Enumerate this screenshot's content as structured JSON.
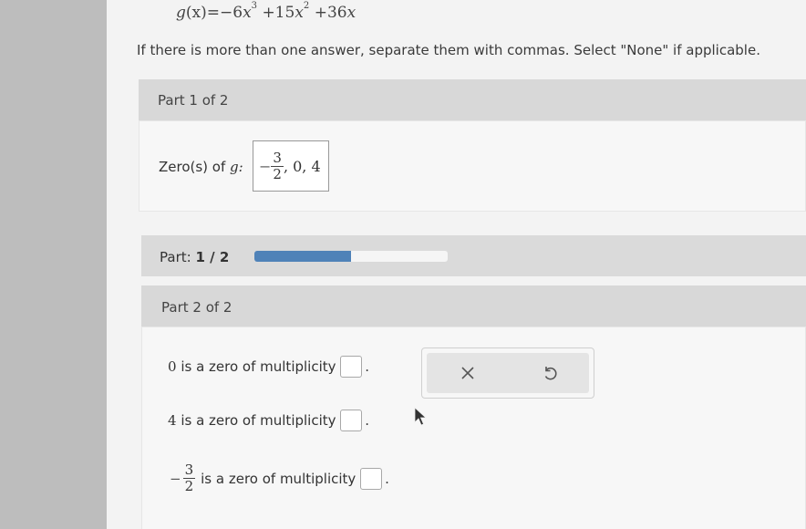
{
  "equation": {
    "lhs": "g",
    "arg": "(x)",
    "c1": "−6",
    "p1": "3",
    "op2": "+15",
    "p2": "2",
    "op3": "+36"
  },
  "instructions": "If there is more than one answer, separate them with commas. Select \"None\" if applicable.",
  "part1": {
    "header": "Part 1 of 2",
    "zero_label": "Zero(s) of",
    "zero_func": "g:",
    "answer": {
      "neg": "−",
      "num": "3",
      "den": "2",
      "rest": ", 0, 4"
    }
  },
  "progress": {
    "label": "Part:",
    "value_text": "1 / 2",
    "fraction": 0.5,
    "color": "#4f82b8"
  },
  "part2": {
    "header": "Part 2 of 2",
    "rows": [
      {
        "zero": "0",
        "text": "is a zero of multiplicity"
      },
      {
        "zero": "4",
        "text": "is a zero of multiplicity"
      },
      {
        "neg": "−",
        "num": "3",
        "den": "2",
        "text": "is a zero of multiplicity"
      }
    ],
    "period": "."
  },
  "tools": {
    "clear_icon": "x-icon",
    "undo_icon": "undo-icon"
  }
}
